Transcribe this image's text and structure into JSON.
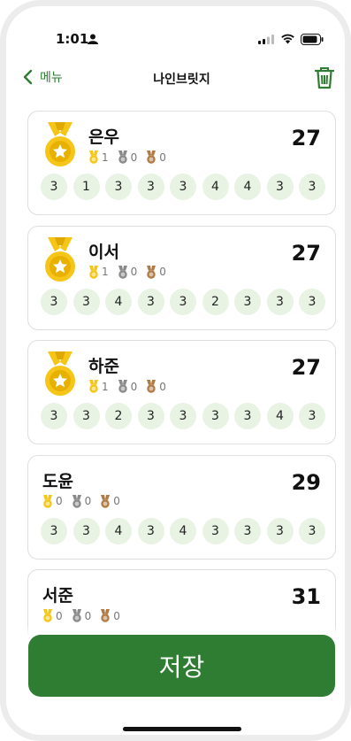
{
  "status_bar": {
    "time": "1:01"
  },
  "nav": {
    "back_label": "메뉴",
    "title": "나인브릿지"
  },
  "players": [
    {
      "name": "은우",
      "score": "27",
      "has_medal": true,
      "gold": "1",
      "silver": "0",
      "bronze": "0",
      "holes": [
        "3",
        "1",
        "3",
        "3",
        "3",
        "4",
        "4",
        "3",
        "3"
      ]
    },
    {
      "name": "이서",
      "score": "27",
      "has_medal": true,
      "gold": "1",
      "silver": "0",
      "bronze": "0",
      "holes": [
        "3",
        "3",
        "4",
        "3",
        "3",
        "2",
        "3",
        "3",
        "3"
      ]
    },
    {
      "name": "하준",
      "score": "27",
      "has_medal": true,
      "gold": "1",
      "silver": "0",
      "bronze": "0",
      "holes": [
        "3",
        "3",
        "2",
        "3",
        "3",
        "3",
        "3",
        "4",
        "3"
      ]
    },
    {
      "name": "도윤",
      "score": "29",
      "has_medal": false,
      "gold": "0",
      "silver": "0",
      "bronze": "0",
      "holes": [
        "3",
        "3",
        "4",
        "3",
        "4",
        "3",
        "3",
        "3",
        "3"
      ]
    },
    {
      "name": "서준",
      "score": "31",
      "has_medal": false,
      "gold": "0",
      "silver": "0",
      "bronze": "0",
      "holes": []
    }
  ],
  "save_button": {
    "label": "저장"
  },
  "colors": {
    "accent": "#2e7d32",
    "gold": "#f5c518",
    "silver": "#8a8a8a",
    "bronze": "#b07b45",
    "hole_bg": "#e8f3e4"
  },
  "icons": {
    "back": "chevron-left-icon",
    "trash": "trash-icon",
    "medal": "gold-medal-icon"
  }
}
